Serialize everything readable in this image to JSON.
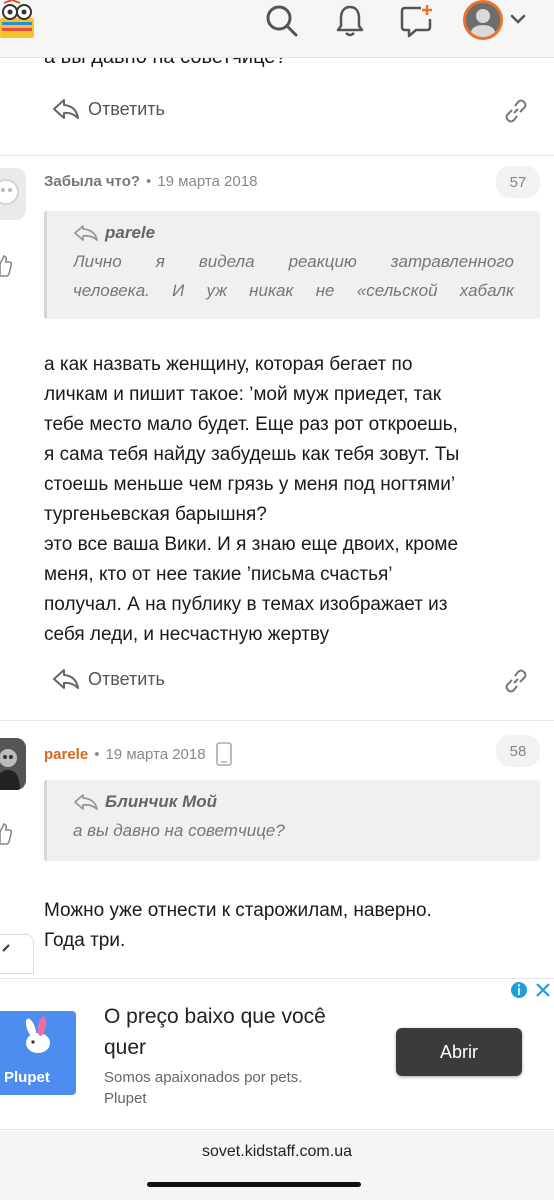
{
  "header": {
    "icons": [
      "search-icon",
      "bell-icon",
      "new-message-icon",
      "profile-icon",
      "chevron-down-icon"
    ],
    "accent": "#e8732c"
  },
  "top_fragment": {
    "text": "а вы давно на советчице?",
    "reply_label": "Ответить"
  },
  "posts": [
    {
      "author": "Забыла что?",
      "separator": "•",
      "date": "19 марта 2018",
      "number": "57",
      "quote": {
        "author": "parele",
        "lines": [
          "Лично я видела реакцию затравленного",
          "человека. И уж никак не «сельской хабалк"
        ]
      },
      "text_lines": [
        "а как назвать женщину, которая бегает по",
        "личкам и пишит такое: ’мой муж приедет, так",
        "тебе место мало будет. Еще раз рот откроешь,",
        "я сама тебя найду забудешь как тебя зовут. Ты",
        "стоешь меньше чем грязь у меня под ногтями’",
        "тургеньевская барышня?",
        "это все ваша Вики. И я знаю еще двоих, кроме",
        "меня, кто от нее такие ’письма счастья’",
        "получал. А на публику в темах изображает из",
        "себя леди, и несчастную жертву"
      ],
      "reply_label": "Ответить"
    },
    {
      "author": "parele",
      "separator": "•",
      "date": "19 марта 2018",
      "number": "58",
      "quote": {
        "author": "Блинчик Мой",
        "lines": [
          "а вы давно на советчице?"
        ]
      },
      "text_lines": [
        "Можно уже отнести к старожилам, наверно.",
        "Года три."
      ]
    }
  ],
  "ad": {
    "brand": "Plupet",
    "title": "O preço baixo que você quer",
    "subtitle": "Somos apaixonados por pets.",
    "advertiser": "Plupet",
    "button": "Abrir",
    "button_color": "#3b3b3b",
    "logo_color": "#4d8df0"
  },
  "browser": {
    "url": "sovet.kidstaff.com.ua"
  }
}
